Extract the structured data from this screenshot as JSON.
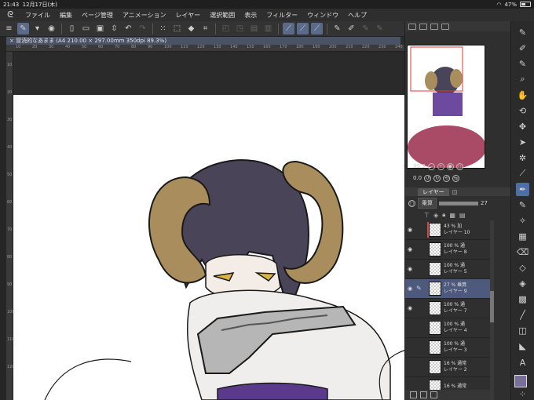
{
  "status": {
    "time": "21:43",
    "date": "12月17日(木)",
    "battery": "47%",
    "battery_level": 0.47
  },
  "menu": [
    "ファイル",
    "編集",
    "ページ管理",
    "アニメーション",
    "レイヤー",
    "選択範囲",
    "表示",
    "フィルター",
    "ウィンドウ",
    "ヘルプ"
  ],
  "document": {
    "tab_label": "× 冒涜的なあまま (A4 210.00 × 297.00mm 350dpi 89.3%)"
  },
  "ruler": {
    "top": [
      "10",
      "20",
      "30",
      "40",
      "50",
      "60",
      "70",
      "80",
      "90",
      "100",
      "110",
      "120",
      "130",
      "140",
      "150",
      "160",
      "170",
      "180",
      "190",
      "200",
      "210",
      "220",
      "230",
      "240"
    ],
    "left": [
      "10",
      "20",
      "30",
      "40",
      "50",
      "60",
      "70",
      "80",
      "90",
      "100",
      "110",
      "120"
    ]
  },
  "navigator": {
    "zoom": "89.3",
    "rotation": "0.0"
  },
  "layer_panel": {
    "tab_label": "レイヤー",
    "blend_mode": "乗算",
    "opacity": "27"
  },
  "layers": [
    {
      "opacity": "43 %",
      "blend": "加",
      "name": "レイヤー 10",
      "visible": true,
      "selected": false,
      "mark": true
    },
    {
      "opacity": "100 %",
      "blend": "通",
      "name": "レイヤー 8",
      "visible": true,
      "selected": false,
      "mark": false
    },
    {
      "opacity": "100 %",
      "blend": "通",
      "name": "レイヤー 5",
      "visible": true,
      "selected": false,
      "mark": false
    },
    {
      "opacity": "27 %",
      "blend": "乗算",
      "name": "レイヤー 9",
      "visible": true,
      "selected": true,
      "mark": false
    },
    {
      "opacity": "100 %",
      "blend": "通",
      "name": "レイヤー 7",
      "visible": true,
      "selected": false,
      "mark": false
    },
    {
      "opacity": "100 %",
      "blend": "通",
      "name": "レイヤー 4",
      "visible": false,
      "selected": false,
      "mark": false
    },
    {
      "opacity": "100 %",
      "blend": "通",
      "name": "レイヤー 3",
      "visible": false,
      "selected": false,
      "mark": false
    },
    {
      "opacity": "16 %",
      "blend": "通常",
      "name": "レイヤー 2",
      "visible": false,
      "selected": false,
      "mark": false
    },
    {
      "opacity": "16 %",
      "blend": "通常",
      "name": "",
      "visible": false,
      "selected": false,
      "mark": false
    }
  ],
  "colors": {
    "accent": "#4c6fa8",
    "selected_layer": "#4d5a7e",
    "main_color": "#7a6f9a"
  }
}
